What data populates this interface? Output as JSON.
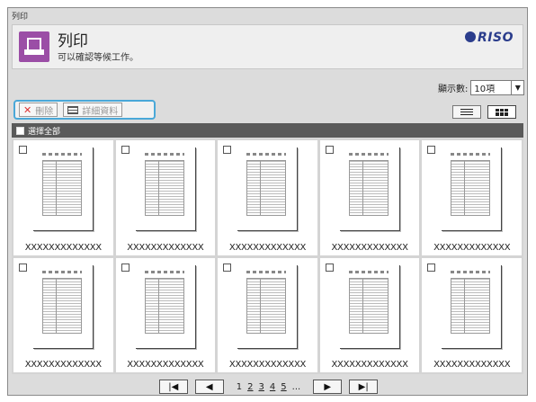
{
  "window_title": "列印",
  "header": {
    "title": "列印",
    "subtitle": "可以確認等候工作。",
    "logo": "RISO"
  },
  "display_count": {
    "label": "顯示數:",
    "value": "10項"
  },
  "toolbar": {
    "delete_label": "刪除",
    "details_label": "詳細資料"
  },
  "select_all_label": "選擇全部",
  "jobs": [
    {
      "name": "XXXXXXXXXXXXX"
    },
    {
      "name": "XXXXXXXXXXXXX"
    },
    {
      "name": "XXXXXXXXXXXXX"
    },
    {
      "name": "XXXXXXXXXXXXX"
    },
    {
      "name": "XXXXXXXXXXXXX"
    },
    {
      "name": "XXXXXXXXXXXXX"
    },
    {
      "name": "XXXXXXXXXXXXX"
    },
    {
      "name": "XXXXXXXXXXXXX"
    },
    {
      "name": "XXXXXXXXXXXXX"
    },
    {
      "name": "XXXXXXXXXXXXX"
    }
  ],
  "pagination": {
    "pages": [
      "1",
      "2",
      "3",
      "4",
      "5"
    ],
    "ellipsis": "...",
    "first_icon": "first-page-icon",
    "prev_icon": "prev-page-icon",
    "next_icon": "next-page-icon",
    "last_icon": "last-page-icon"
  },
  "colors": {
    "accent": "#4aa8d8",
    "app_icon": "#9b4ea6",
    "logo": "#2b3d8c",
    "select_bar": "#5a5a5a"
  }
}
